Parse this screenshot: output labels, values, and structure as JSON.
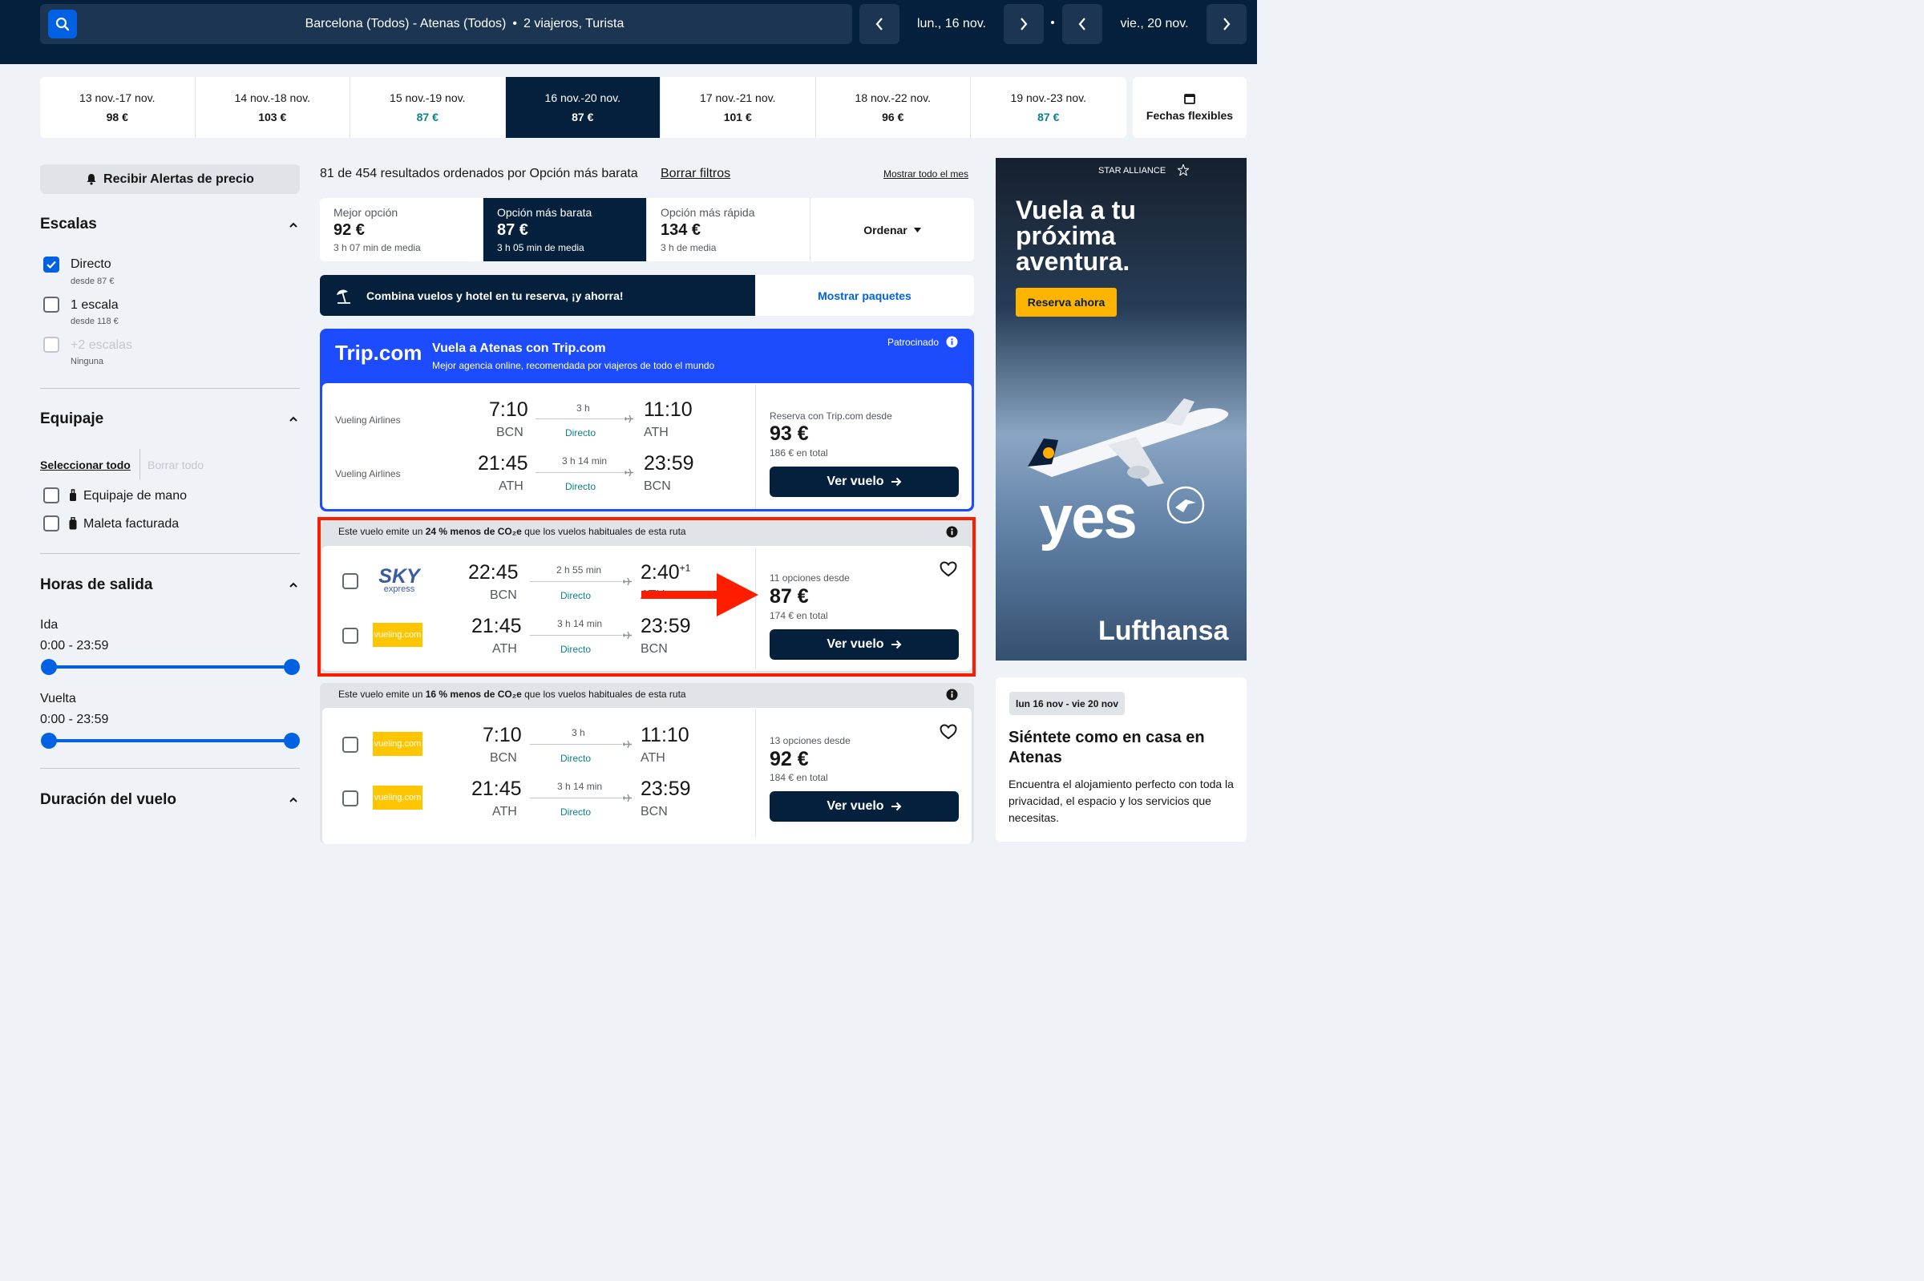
{
  "header": {
    "search_route": "Barcelona (Todos) - Atenas (Todos)",
    "search_sep": "•",
    "search_travelers": "2 viajeros, Turista",
    "depart_date": "lun., 16 nov.",
    "return_date": "vie., 20 nov."
  },
  "date_tabs": [
    {
      "label": "13 nov.-17 nov.",
      "price": "98 €"
    },
    {
      "label": "14 nov.-18 nov.",
      "price": "103 €"
    },
    {
      "label": "15 nov.-19 nov.",
      "price": "87 €"
    },
    {
      "label": "16 nov.-20 nov.",
      "price": "87 €"
    },
    {
      "label": "17 nov.-21 nov.",
      "price": "101 €"
    },
    {
      "label": "18 nov.-22 nov.",
      "price": "96 €"
    },
    {
      "label": "19 nov.-23 nov.",
      "price": "87 €"
    }
  ],
  "flexible_dates": "Fechas flexibles",
  "sidebar": {
    "price_alert": "Recibir Alertas de precio",
    "stops_title": "Escalas",
    "stops": [
      {
        "label": "Directo",
        "sub": "desde 87 €"
      },
      {
        "label": "1 escala",
        "sub": "desde 118 €"
      },
      {
        "label": "+2 escalas",
        "sub": "Ninguna"
      }
    ],
    "baggage_title": "Equipaje",
    "select_all": "Seleccionar todo",
    "clear_all": "Borrar todo",
    "baggage": [
      "Equipaje de mano",
      "Maleta facturada"
    ],
    "times_title": "Horas de salida",
    "outbound_label": "Ida",
    "outbound_range": "0:00 - 23:59",
    "return_label": "Vuelta",
    "return_range": "0:00 - 23:59",
    "duration_title": "Duración del vuelo"
  },
  "results": {
    "count_text": "81 de 454 resultados ordenados por Opción más barata",
    "clear_filters": "Borrar filtros",
    "show_month": "Mostrar todo el mes",
    "sort_tabs": [
      {
        "label": "Mejor opción",
        "price": "92 €",
        "sub": "3 h 07 min de media"
      },
      {
        "label": "Opción más barata",
        "price": "87 €",
        "sub": "3 h 05 min de media"
      },
      {
        "label": "Opción más rápida",
        "price": "134 €",
        "sub": "3 h de media"
      }
    ],
    "order_label": "Ordenar",
    "promo_text": "Combina vuelos y hotel en tu reserva, ¡y ahorra!",
    "promo_button": "Mostrar paquetes"
  },
  "sponsored": {
    "brand": "Trip.com",
    "title": "Vuela a Atenas con Trip.com",
    "subtitle": "Mejor agencia online, recomendada por viajeros de todo el mundo",
    "badge": "Patrocinado",
    "legs": [
      {
        "airline": "Vueling Airlines",
        "dep": "7:10",
        "from": "BCN",
        "dur": "3 h",
        "stops": "Directo",
        "arr": "11:10",
        "to": "ATH"
      },
      {
        "airline": "Vueling Airlines",
        "dep": "21:45",
        "from": "ATH",
        "dur": "3 h 14 min",
        "stops": "Directo",
        "arr": "23:59",
        "to": "BCN"
      }
    ],
    "price_label": "Reserva con Trip.com desde",
    "price": "93 €",
    "total": "186 € en total",
    "button": "Ver vuelo"
  },
  "cards": [
    {
      "eco_pre": "Este vuelo emite un ",
      "eco_bold": "24 % menos de CO₂e",
      "eco_post": " que los vuelos habituales de esta ruta",
      "legs": [
        {
          "logo": "SKY express",
          "dep": "22:45",
          "from": "BCN",
          "dur": "2 h 55 min",
          "stops": "Directo",
          "arr": "2:40",
          "arr_sup": "+1",
          "to": "ATH"
        },
        {
          "logo": "vueling.com",
          "dep": "21:45",
          "from": "ATH",
          "dur": "3 h 14 min",
          "stops": "Directo",
          "arr": "23:59",
          "arr_sup": "",
          "to": "BCN"
        }
      ],
      "options": "11 opciones desde",
      "price": "87 €",
      "total": "174 € en total",
      "button": "Ver vuelo"
    },
    {
      "eco_pre": "Este vuelo emite un ",
      "eco_bold": "16 % menos de CO₂e",
      "eco_post": " que los vuelos habituales de esta ruta",
      "legs": [
        {
          "logo": "vueling.com",
          "dep": "7:10",
          "from": "BCN",
          "dur": "3 h",
          "stops": "Directo",
          "arr": "11:10",
          "arr_sup": "",
          "to": "ATH"
        },
        {
          "logo": "vueling.com",
          "dep": "21:45",
          "from": "ATH",
          "dur": "3 h 14 min",
          "stops": "Directo",
          "arr": "23:59",
          "arr_sup": "",
          "to": "BCN"
        }
      ],
      "options": "13 opciones desde",
      "price": "92 €",
      "total": "184 € en total",
      "button": "Ver vuelo"
    }
  ],
  "ad": {
    "alliance": "STAR ALLIANCE",
    "headline": "Vuela a tu próxima aventura.",
    "cta": "Reserva ahora",
    "slogan": "yes",
    "brand": "Lufthansa"
  },
  "hotel": {
    "dates": "lun 16 nov - vie 20 nov",
    "title": "Siéntete como en casa en Atenas",
    "text": "Encuentra el alojamiento perfecto con toda la privacidad, el espacio y los servicios que necesitas."
  },
  "colors": {
    "navy": "#05203c",
    "blue": "#0062e3",
    "teal": "#0c838a",
    "trip_blue": "#1d4cfe",
    "highlight": "#ff1d00",
    "ad_cta": "#ffb400"
  }
}
